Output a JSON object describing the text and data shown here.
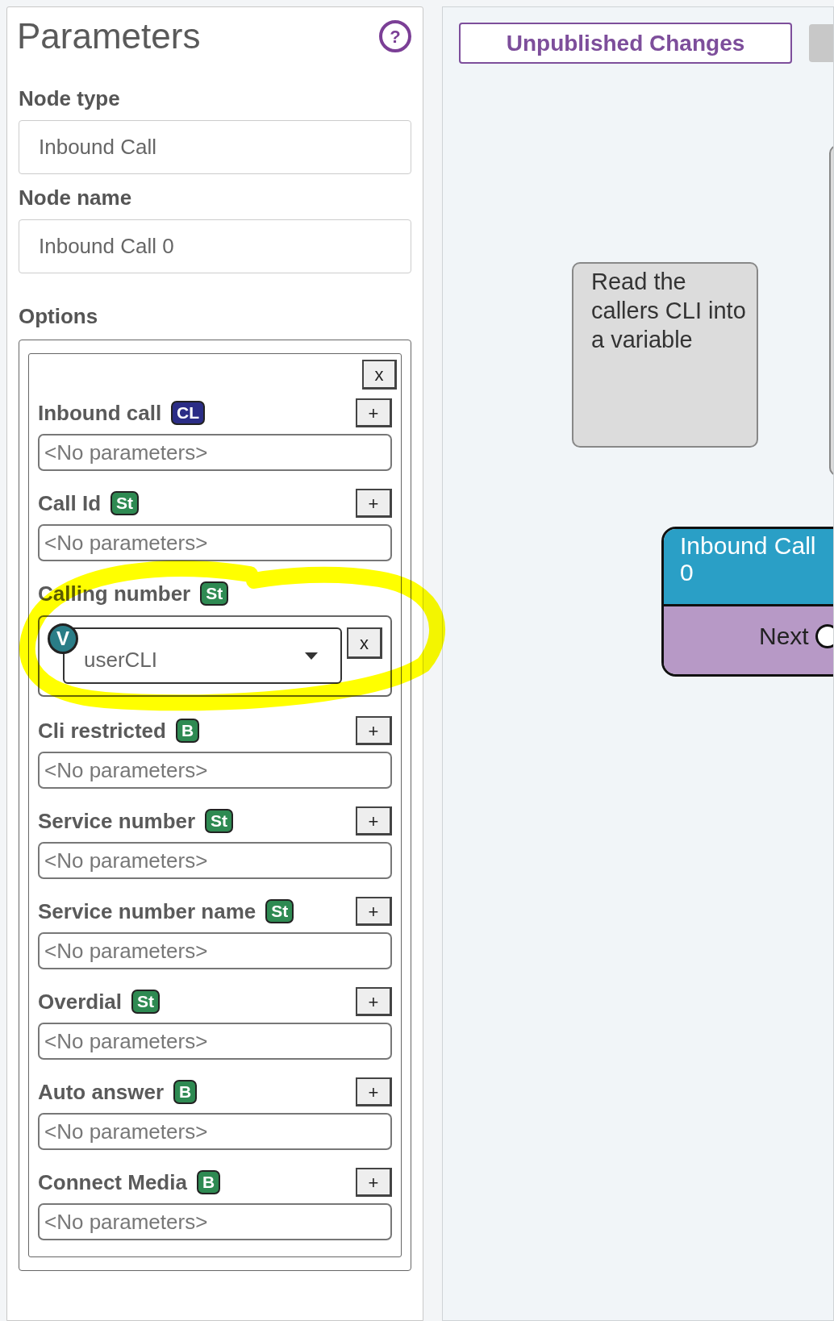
{
  "panel": {
    "title": "Parameters",
    "help_button": "?",
    "fields": [
      {
        "label": "Node type",
        "value": "Inbound Call"
      },
      {
        "label": "Node name",
        "value": "Inbound Call 0"
      }
    ],
    "options": {
      "label": "Options",
      "close_button": "x",
      "items": [
        {
          "kind": "empty",
          "label": "Inbound call",
          "badge": "CL",
          "color": "#2b2d86",
          "add_button": "+",
          "placeholder": "<No parameters>"
        },
        {
          "kind": "empty",
          "label": "Call Id",
          "badge": "St",
          "color": "#2e8a52",
          "add_button": "+",
          "placeholder": "<No parameters>"
        },
        {
          "kind": "variable",
          "label": "Calling number",
          "badge": "St",
          "color": "#2e8a52",
          "variable_badge": "V",
          "value": "userCLI",
          "remove_button": "x"
        },
        {
          "kind": "empty",
          "label": "Cli restricted",
          "badge": "B",
          "color": "#2e8a52",
          "add_button": "+",
          "placeholder": "<No parameters>"
        },
        {
          "kind": "empty",
          "label": "Service number",
          "badge": "St",
          "color": "#2e8a52",
          "add_button": "+",
          "placeholder": "<No parameters>"
        },
        {
          "kind": "empty",
          "label": "Service number name",
          "badge": "St",
          "color": "#2e8a52",
          "add_button": "+",
          "placeholder": "<No parameters>"
        },
        {
          "kind": "empty",
          "label": "Overdial",
          "badge": "St",
          "color": "#2e8a52",
          "add_button": "+",
          "placeholder": "<No parameters>"
        },
        {
          "kind": "empty",
          "label": "Auto answer",
          "badge": "B",
          "color": "#2e8a52",
          "add_button": "+",
          "placeholder": "<No parameters>"
        },
        {
          "kind": "empty",
          "label": "Connect Media",
          "badge": "B",
          "color": "#2e8a52",
          "add_button": "+",
          "placeholder": "<No parameters>"
        }
      ]
    }
  },
  "canvas": {
    "toolbar": {
      "button": "Unpublished Changes"
    },
    "note": {
      "text": "Read the callers CLI into a variable"
    },
    "node": {
      "title_lines": [
        "Inbound Call",
        "0"
      ],
      "ports": [
        {
          "label": "Next"
        }
      ]
    }
  }
}
